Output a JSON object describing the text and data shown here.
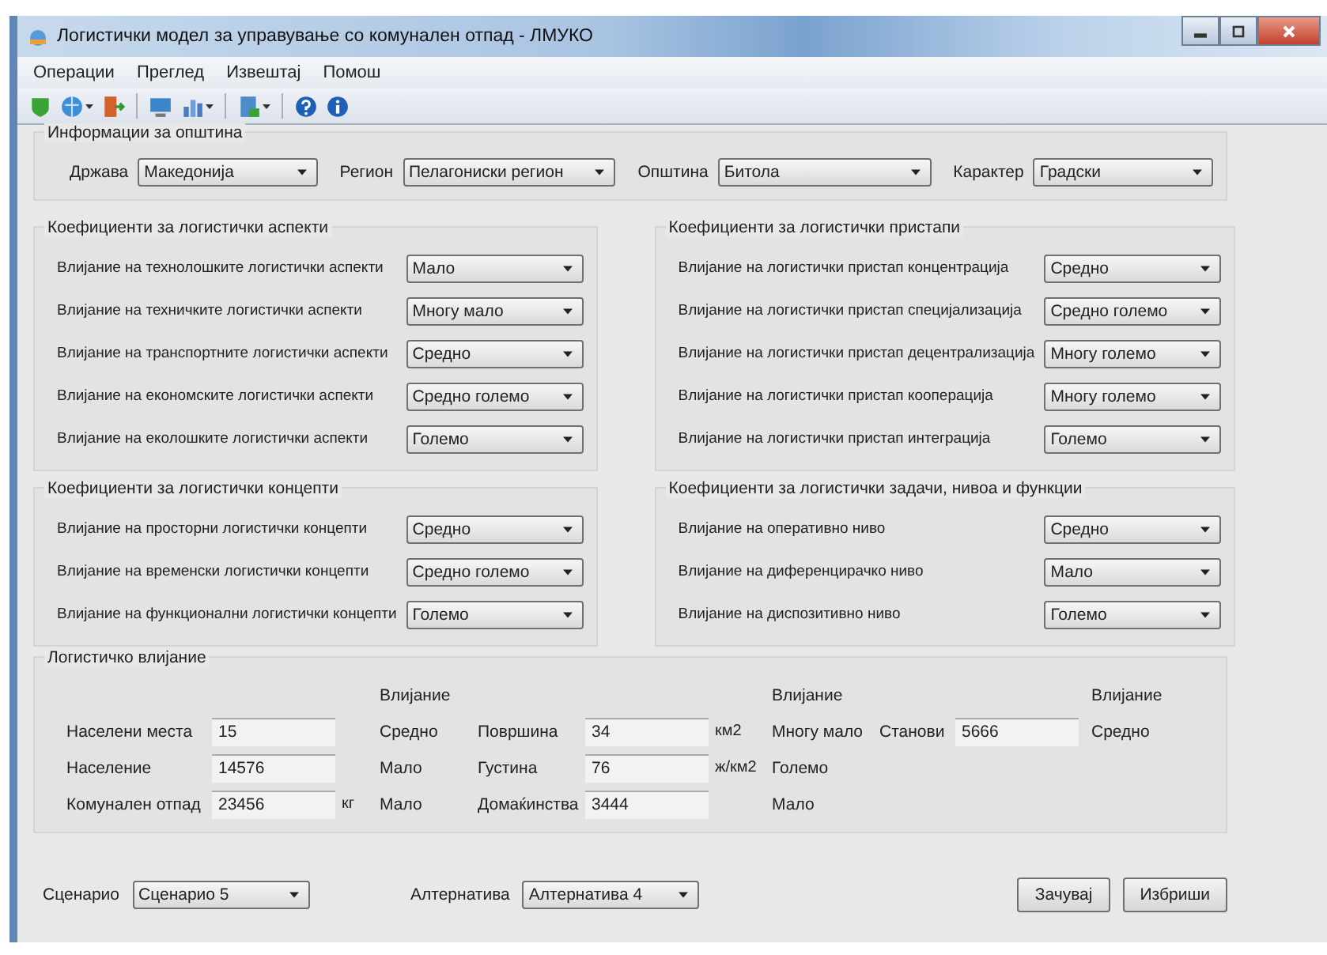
{
  "window": {
    "title": "Логистички модел за управување со комунален отпад - ЛМУКО"
  },
  "menu": [
    "Операции",
    "Преглед",
    "Извештај",
    "Помош"
  ],
  "municipality_info": {
    "title": "Информации за општина",
    "fields": [
      {
        "label": "Држава",
        "value": "Македонија"
      },
      {
        "label": "Регион",
        "value": "Пелагониски регион"
      },
      {
        "label": "Општина",
        "value": "Битола"
      },
      {
        "label": "Карактер",
        "value": "Градски"
      }
    ]
  },
  "coefficient_columns": [
    [
      {
        "title": "Коефициенти за логистички аспекти",
        "rows": [
          {
            "label": "Влијание на технолошките логистички аспекти",
            "value": "Мало"
          },
          {
            "label": "Влијание на техничките логистички аспекти",
            "value": "Многу мало"
          },
          {
            "label": "Влијание на транспортните логистички аспекти",
            "value": "Средно"
          },
          {
            "label": "Влијание на економските логистички аспекти",
            "value": "Средно големо"
          },
          {
            "label": "Влијание на еколошките логистички аспекти",
            "value": "Големо"
          }
        ]
      },
      {
        "title": "Коефициенти за логистички концепти",
        "rows": [
          {
            "label": "Влијание на просторни логистички концепти",
            "value": "Средно"
          },
          {
            "label": "Влијание на временски логистички концепти",
            "value": "Средно големо"
          },
          {
            "label": "Влијание на функционални логистички концепти",
            "value": "Големо"
          }
        ]
      }
    ],
    [
      {
        "title": "Коефициенти за логистички пристапи",
        "rows": [
          {
            "label": "Влијание на логистички пристап концентрација",
            "value": "Средно"
          },
          {
            "label": "Влијание на логистички пристап специјализација",
            "value": "Средно големо"
          },
          {
            "label": "Влијание на логистички пристап децентрализација",
            "value": "Многу големо"
          },
          {
            "label": "Влијание на логистички пристап кооперација",
            "value": "Многу големо"
          },
          {
            "label": "Влијание на логистички пристап интеграција",
            "value": "Големо"
          }
        ]
      },
      {
        "title": "Коефициенти за логистички задачи, нивоа и функции",
        "rows": [
          {
            "label": "Влијание на оперативно ниво",
            "value": "Средно"
          },
          {
            "label": "Влијание на диференцирачко ниво",
            "value": "Мало"
          },
          {
            "label": "Влијание на диспозитивно ниво",
            "value": "Големо"
          }
        ]
      }
    ]
  ],
  "logistic_influence": {
    "title": "Логистичко влијание",
    "headers": [
      "Влијание",
      "Влијание",
      "Влијание"
    ],
    "rows": [
      [
        {
          "label": "Населени места",
          "value": "15",
          "influence": "Средно"
        },
        {
          "label": "Површина",
          "value": "34",
          "unit": "км2",
          "influence": "Многу мало"
        },
        {
          "label": "Станови",
          "value": "5666",
          "influence": "Средно"
        }
      ],
      [
        {
          "label": "Население",
          "value": "14576",
          "influence": "Мало"
        },
        {
          "label": "Густина",
          "value": "76",
          "unit": "ж/км2",
          "influence": "Големо"
        }
      ],
      [
        {
          "label": "Комунален отпад",
          "value": "23456",
          "unit": "кг",
          "influence": "Мало"
        },
        {
          "label": "Домаќинства",
          "value": "3444",
          "influence": "Мало"
        }
      ]
    ]
  },
  "scenario": {
    "label": "Сценарио",
    "value": "Сценарио 5"
  },
  "alternative": {
    "label": "Алтернатива",
    "value": "Алтернатива 4"
  },
  "buttons": [
    "Зачувај",
    "Избриши"
  ]
}
